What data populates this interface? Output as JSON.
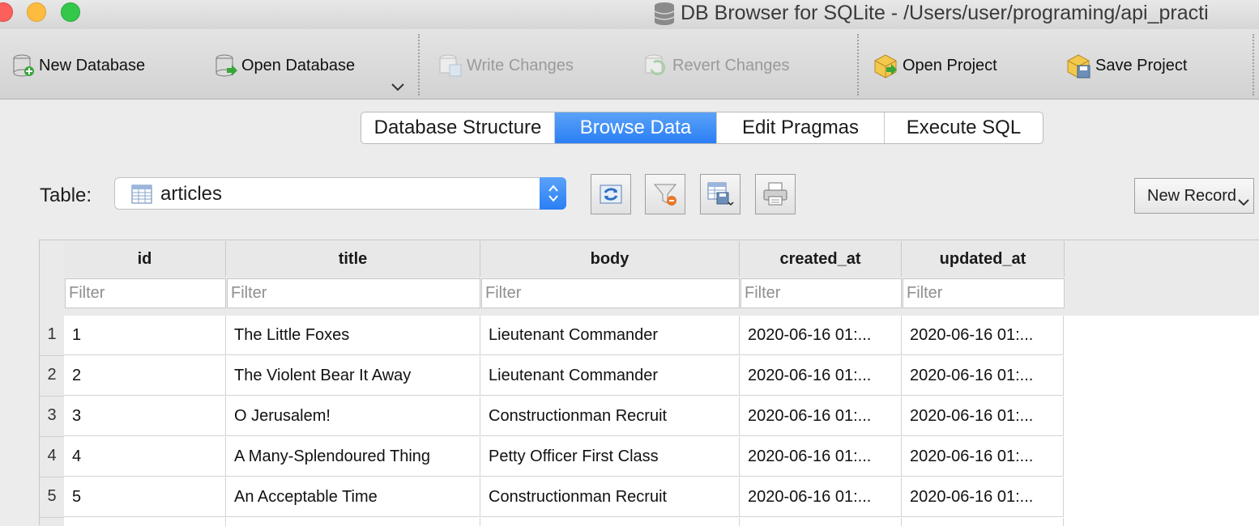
{
  "window": {
    "title": "DB Browser for SQLite - /Users/user/programing/api_practi"
  },
  "toolbar": {
    "new_database": "New Database",
    "open_database": "Open Database",
    "write_changes": "Write Changes",
    "revert_changes": "Revert Changes",
    "open_project": "Open Project",
    "save_project": "Save Project"
  },
  "tabs": [
    {
      "label": "Database Structure",
      "active": false
    },
    {
      "label": "Browse Data",
      "active": true
    },
    {
      "label": "Edit Pragmas",
      "active": false
    },
    {
      "label": "Execute SQL",
      "active": false
    }
  ],
  "browse": {
    "table_label": "Table:",
    "selected_table": "articles",
    "new_record_label": "New Record"
  },
  "grid": {
    "columns": [
      "id",
      "title",
      "body",
      "created_at",
      "updated_at"
    ],
    "filter_placeholder": "Filter",
    "rows": [
      {
        "num": "1",
        "cells": [
          "1",
          "The Little Foxes",
          "Lieutenant Commander",
          "2020-06-16 01:...",
          "2020-06-16 01:..."
        ]
      },
      {
        "num": "2",
        "cells": [
          "2",
          "The Violent Bear It Away",
          "Lieutenant Commander",
          "2020-06-16 01:...",
          "2020-06-16 01:..."
        ]
      },
      {
        "num": "3",
        "cells": [
          "3",
          "O Jerusalem!",
          "Constructionman Recruit",
          "2020-06-16 01:...",
          "2020-06-16 01:..."
        ]
      },
      {
        "num": "4",
        "cells": [
          "4",
          "A Many-Splendoured Thing",
          "Petty Officer First Class",
          "2020-06-16 01:...",
          "2020-06-16 01:..."
        ]
      },
      {
        "num": "5",
        "cells": [
          "5",
          "An Acceptable Time",
          "Constructionman Recruit",
          "2020-06-16 01:...",
          "2020-06-16 01:..."
        ]
      }
    ]
  },
  "colors": {
    "accent": "#3e8ef7",
    "window_bg": "#ececec"
  }
}
